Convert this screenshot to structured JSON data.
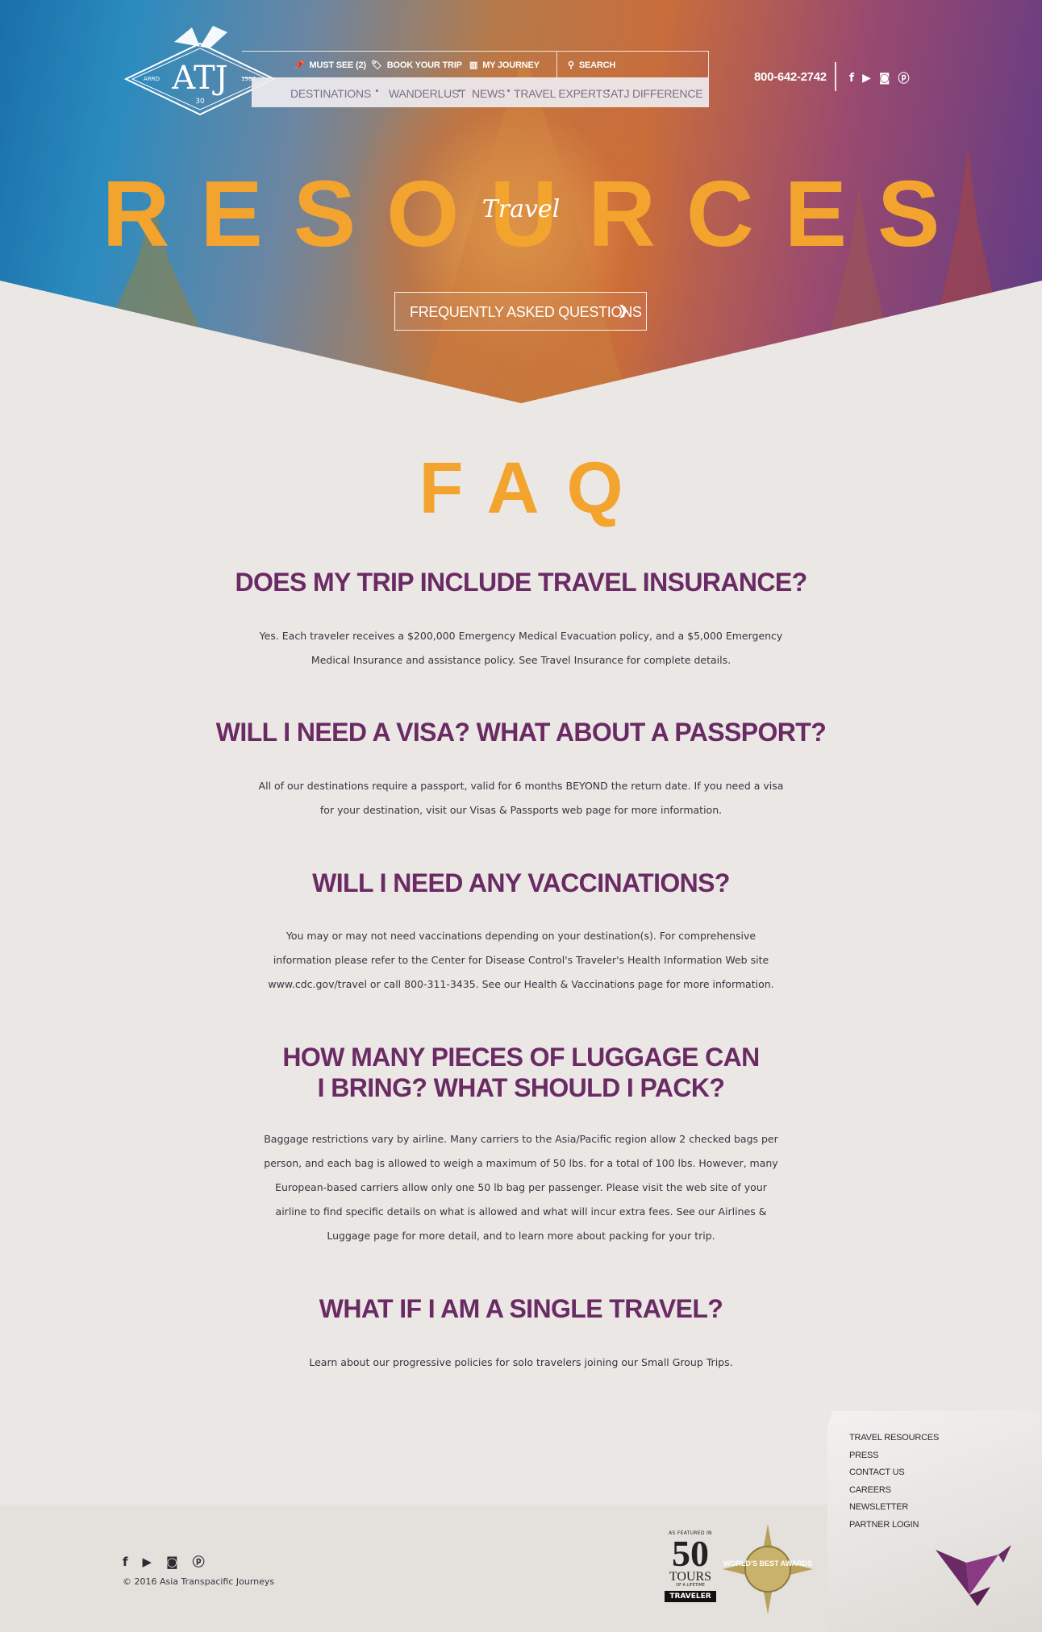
{
  "brand": {
    "logo_text": "ATJ",
    "logo_left": "ARRD",
    "logo_right": "1987",
    "logo_badge": "30"
  },
  "nav": {
    "top": [
      {
        "label": "MUST SEE (2)",
        "icon": "pin-icon"
      },
      {
        "label": "BOOK YOUR TRIP",
        "icon": "tag-icon"
      },
      {
        "label": "MY JOURNEY",
        "icon": "map-icon"
      },
      {
        "label": "SEARCH",
        "icon": "search-icon"
      }
    ],
    "main": [
      "DESTINATIONS",
      "WANDERLUST",
      "NEWS",
      "TRAVEL EXPERTS",
      "ATJ DIFFERENCE"
    ]
  },
  "header": {
    "phone": "800-642-2742",
    "social": [
      "facebook-icon",
      "youtube-icon",
      "instagram-icon",
      "pinterest-icon"
    ]
  },
  "hero": {
    "title": "RESOURCES",
    "script": "Travel",
    "dropdown_label": "FREQUENTLY ASKED QUESTIONS"
  },
  "faq": {
    "title": "FAQ",
    "items": [
      {
        "question": "DOES MY TRIP INCLUDE TRAVEL INSURANCE?",
        "answer": "Yes. Each traveler receives a $200,000 Emergency Medical Evacuation policy, and a $5,000 Emergency Medical Insurance and assistance policy. See Travel Insurance for complete details."
      },
      {
        "question": "WILL I NEED A VISA? WHAT ABOUT A PASSPORT?",
        "answer": "All of our destinations require a passport, valid for 6 months BEYOND the return date. If you need a visa for your destination, visit our Visas & Passports web page for more information."
      },
      {
        "question": "WILL I NEED ANY VACCINATIONS?",
        "answer": "You may or may not need vaccinations depending on your destination(s). For comprehensive information please refer to the Center for Disease Control's Traveler's Health Information Web site www.cdc.gov/travel or call 800-311-3435. See our Health & Vaccinations page for more information."
      },
      {
        "question": "HOW MANY PIECES OF LUGGAGE CAN I BRING? WHAT SHOULD I PACK?",
        "answer": "Baggage restrictions vary by airline. Many carriers to the Asia/Pacific region allow 2 checked bags per person, and each bag is allowed to weigh a maximum of 50 lbs. for a total of 100 lbs. However, many European-based carriers allow only one 50 lb bag per passenger. Please visit the web site of your airline to find specific details on what is allowed and what will incur extra fees. See our Airlines & Luggage page for more detail, and to learn more about packing for your trip."
      },
      {
        "question": "WHAT IF I AM A SINGLE TRAVEL?",
        "answer": "Learn about our progressive policies for solo travelers joining our Small Group Trips."
      }
    ]
  },
  "footer": {
    "copyright": "© 2016 Asia Transpacific Journeys",
    "badge": {
      "featured": "AS FEATURED IN",
      "number": "50",
      "tours": "TOURS",
      "lifetime": "OF A LIFETIME",
      "pub": "TRAVELER"
    },
    "award": "WORLD'S BEST AWARDS",
    "links": [
      "TRAVEL RESOURCES",
      "PRESS",
      "CONTACT US",
      "CAREERS",
      "NEWSLETTER",
      "PARTNER LOGIN"
    ]
  },
  "colors": {
    "accent_orange": "#f3a42f",
    "heading_purple": "#6a2a64",
    "background": "#ebe7e4"
  }
}
